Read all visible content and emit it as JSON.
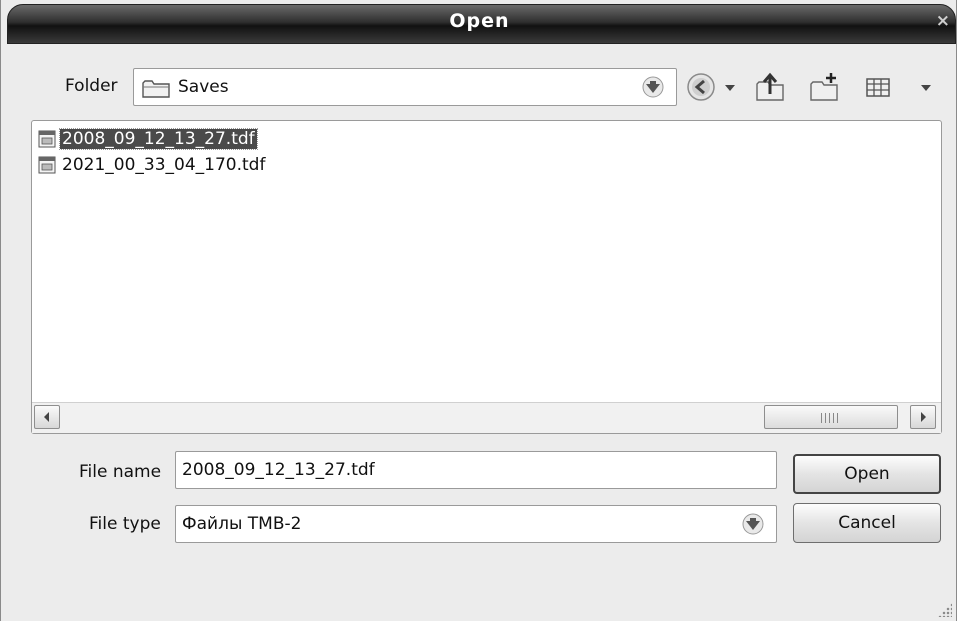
{
  "window": {
    "title": "Open",
    "close_label": "×"
  },
  "toolbar": {
    "folder_label": "Folder",
    "folder_value": "Saves",
    "icons": [
      "folder-icon",
      "combo-arrow-icon",
      "back-icon",
      "back-dropdown-icon",
      "up-folder-icon",
      "new-folder-icon",
      "view-menu-icon",
      "view-dropdown-icon"
    ]
  },
  "files": [
    {
      "name": "2008_09_12_13_27.tdf",
      "selected": true
    },
    {
      "name": "2021_00_33_04_170.tdf",
      "selected": false
    }
  ],
  "form": {
    "file_name_label": "File name",
    "file_name_value": "2008_09_12_13_27.tdf",
    "file_type_label": "File type",
    "file_type_value": "Файлы ТМВ-2",
    "open_button": "Open",
    "cancel_button": "Cancel"
  }
}
